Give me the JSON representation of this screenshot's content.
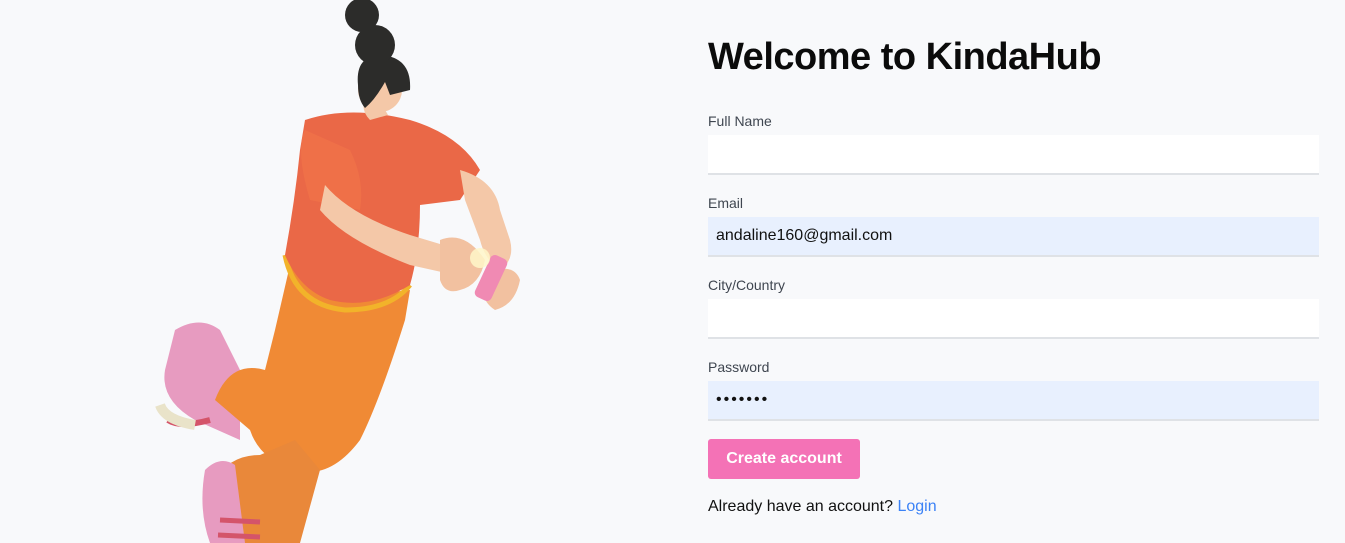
{
  "page": {
    "title": "Welcome to KindaHub"
  },
  "form": {
    "full_name": {
      "label": "Full Name",
      "value": ""
    },
    "email": {
      "label": "Email",
      "value": "andaline160@gmail.com"
    },
    "city": {
      "label": "City/Country",
      "value": ""
    },
    "password": {
      "label": "Password",
      "value": "•••••••"
    },
    "submit_label": "Create account"
  },
  "footer": {
    "prompt": "Already have an account?",
    "login_label": "Login"
  },
  "colors": {
    "background": "#f8f9fb",
    "button": "#f472b6",
    "link": "#3b82f6",
    "autofill": "#e8f0fe"
  }
}
